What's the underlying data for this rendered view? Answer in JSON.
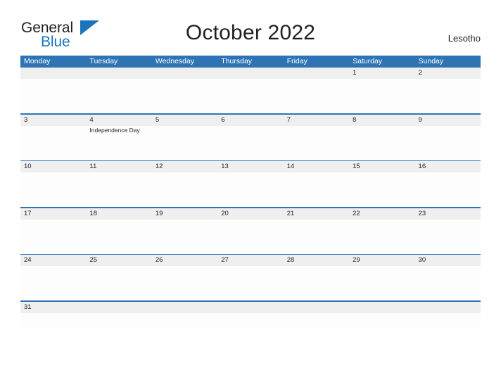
{
  "brand": {
    "name_part1": "General",
    "name_part2": "Blue",
    "triangle_icon": "triangle-icon"
  },
  "header": {
    "title": "October 2022",
    "country": "Lesotho"
  },
  "colors": {
    "header_blue": "#2e74b5",
    "date_strip_gray": "#efefef",
    "brand_blue": "#1b75bb",
    "text_dark": "#231f20"
  },
  "calendar": {
    "day_names": [
      "Monday",
      "Tuesday",
      "Wednesday",
      "Thursday",
      "Friday",
      "Saturday",
      "Sunday"
    ],
    "weeks": [
      {
        "days": [
          {
            "date": "",
            "event": ""
          },
          {
            "date": "",
            "event": ""
          },
          {
            "date": "",
            "event": ""
          },
          {
            "date": "",
            "event": ""
          },
          {
            "date": "",
            "event": ""
          },
          {
            "date": "1",
            "event": ""
          },
          {
            "date": "2",
            "event": ""
          }
        ]
      },
      {
        "days": [
          {
            "date": "3",
            "event": ""
          },
          {
            "date": "4",
            "event": "Independence Day"
          },
          {
            "date": "5",
            "event": ""
          },
          {
            "date": "6",
            "event": ""
          },
          {
            "date": "7",
            "event": ""
          },
          {
            "date": "8",
            "event": ""
          },
          {
            "date": "9",
            "event": ""
          }
        ]
      },
      {
        "days": [
          {
            "date": "10",
            "event": ""
          },
          {
            "date": "11",
            "event": ""
          },
          {
            "date": "12",
            "event": ""
          },
          {
            "date": "13",
            "event": ""
          },
          {
            "date": "14",
            "event": ""
          },
          {
            "date": "15",
            "event": ""
          },
          {
            "date": "16",
            "event": ""
          }
        ]
      },
      {
        "days": [
          {
            "date": "17",
            "event": ""
          },
          {
            "date": "18",
            "event": ""
          },
          {
            "date": "19",
            "event": ""
          },
          {
            "date": "20",
            "event": ""
          },
          {
            "date": "21",
            "event": ""
          },
          {
            "date": "22",
            "event": ""
          },
          {
            "date": "23",
            "event": ""
          }
        ]
      },
      {
        "days": [
          {
            "date": "24",
            "event": ""
          },
          {
            "date": "25",
            "event": ""
          },
          {
            "date": "26",
            "event": ""
          },
          {
            "date": "27",
            "event": ""
          },
          {
            "date": "28",
            "event": ""
          },
          {
            "date": "29",
            "event": ""
          },
          {
            "date": "30",
            "event": ""
          }
        ]
      },
      {
        "days": [
          {
            "date": "31",
            "event": ""
          },
          {
            "date": "",
            "event": ""
          },
          {
            "date": "",
            "event": ""
          },
          {
            "date": "",
            "event": ""
          },
          {
            "date": "",
            "event": ""
          },
          {
            "date": "",
            "event": ""
          },
          {
            "date": "",
            "event": ""
          }
        ]
      }
    ]
  }
}
